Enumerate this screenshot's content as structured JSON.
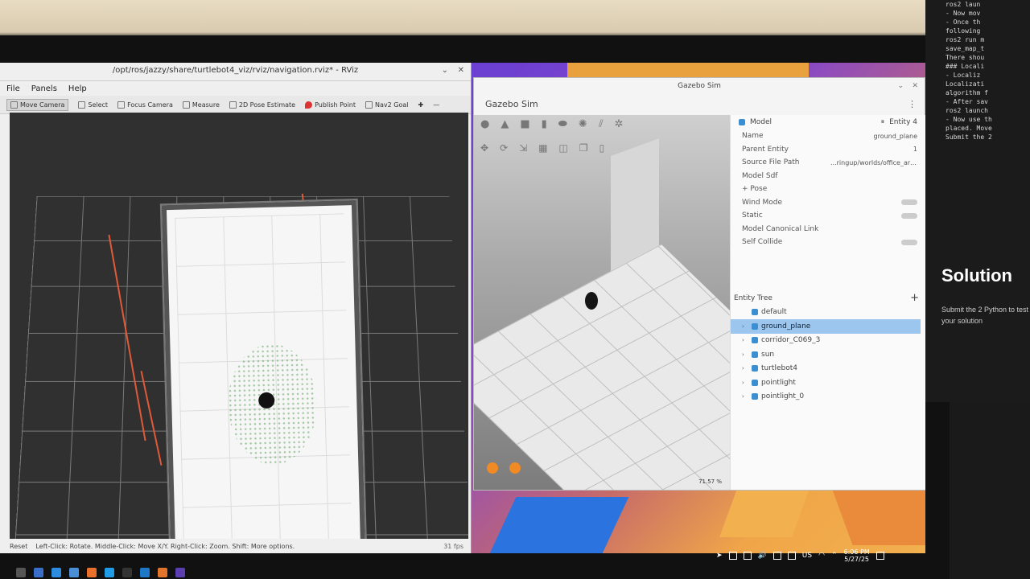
{
  "rviz": {
    "title": "/opt/ros/jazzy/share/turtlebot4_viz/rviz/navigation.rviz* - RViz",
    "menu": [
      "File",
      "Panels",
      "Help"
    ],
    "tools": [
      "Move Camera",
      "Select",
      "Focus Camera",
      "Measure",
      "2D Pose Estimate",
      "Publish Point",
      "Nav2 Goal"
    ],
    "status": {
      "reset": "Reset",
      "hint": "Left-Click: Rotate. Middle-Click: Move X/Y. Right-Click: Zoom. Shift: More options.",
      "fps": "31 fps"
    }
  },
  "gazebo": {
    "window_title": "Gazebo Sim",
    "header": "Gazebo Sim",
    "component": {
      "type": "Model",
      "entity": "Entity 4",
      "props": [
        {
          "k": "Name",
          "v": "ground_plane"
        },
        {
          "k": "Parent Entity",
          "v": "1"
        },
        {
          "k": "Source File Path",
          "v": "...ringup/worlds/office_area.sdf"
        },
        {
          "k": "Model Sdf",
          "v": ""
        },
        {
          "k": "+ Pose",
          "v": ""
        },
        {
          "k": "Wind Mode",
          "v": ""
        },
        {
          "k": "Static",
          "v": ""
        },
        {
          "k": "Model Canonical Link",
          "v": ""
        },
        {
          "k": "Self Collide",
          "v": ""
        }
      ]
    },
    "entity_tree": {
      "title": "Entity Tree",
      "items": [
        "default",
        "ground_plane",
        "corridor_C069_3",
        "sun",
        "turtlebot4",
        "pointlight",
        "pointlight_0"
      ],
      "selected_index": 1
    },
    "rtf": "71.57 %"
  },
  "terminal_side": {
    "lines": [
      "ros2 laun",
      "- Now mov",
      "- Once th",
      "following",
      "",
      "ros2 run m",
      "save_map_t",
      "",
      "There shou",
      "",
      "### Locali",
      "- Localiz",
      "Localizati",
      "algorithm f",
      "- After sav",
      "",
      "ros2 launch",
      "",
      "- Now use th",
      "placed. Move",
      "",
      "Submit the 2"
    ],
    "title": "Solution",
    "sub": "Submit the 2 Python to test your solution"
  },
  "clock": {
    "time": "6:06 PM",
    "date": "5/27/25"
  },
  "tray": {
    "lang": "US"
  }
}
